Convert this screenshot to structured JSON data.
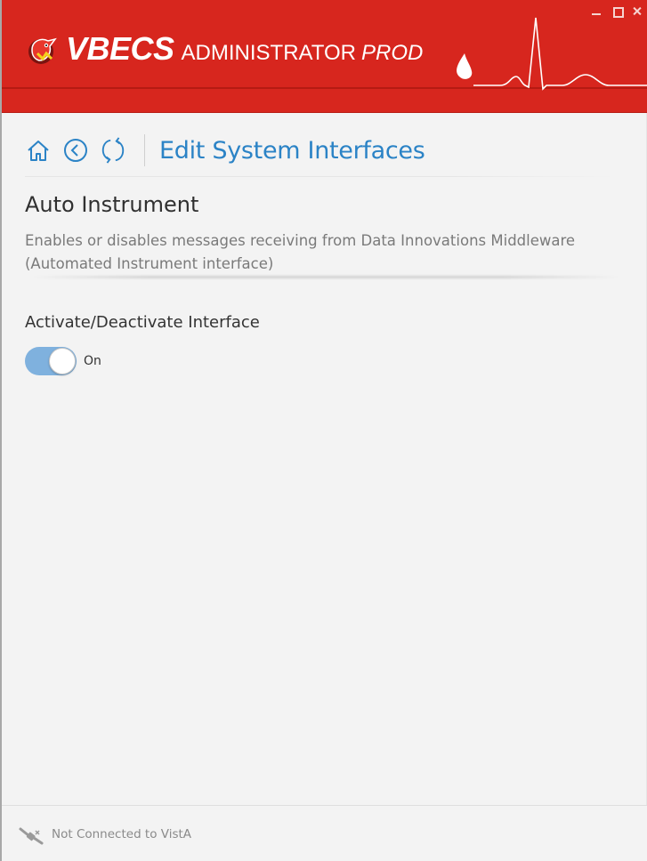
{
  "app": {
    "title_main": "VBECS",
    "title_sub": "ADMINISTRATOR",
    "title_env": "PROD",
    "brand_color": "#d7261e",
    "logo_icon": "vbecs-cardinal-logo"
  },
  "window_controls": {
    "minimize_icon": "minimize-icon",
    "maximize_icon": "maximize-icon",
    "close_icon": "close-icon"
  },
  "nav": {
    "home_icon": "home-icon",
    "back_icon": "back-arrow-icon",
    "refresh_icon": "refresh-icon",
    "page_title": "Edit System Interfaces",
    "title_color": "#2b83c6"
  },
  "section": {
    "title": "Auto Instrument",
    "description": "Enables or disables messages receiving from Data Innovations Middleware (Automated Instrument interface)"
  },
  "interface_toggle": {
    "label": "Activate/Deactivate Interface",
    "state_text": "On",
    "is_on": true,
    "on_color": "#7fb1de"
  },
  "status": {
    "icon": "disconnected-plug-icon",
    "text": "Not Connected to VistA"
  }
}
